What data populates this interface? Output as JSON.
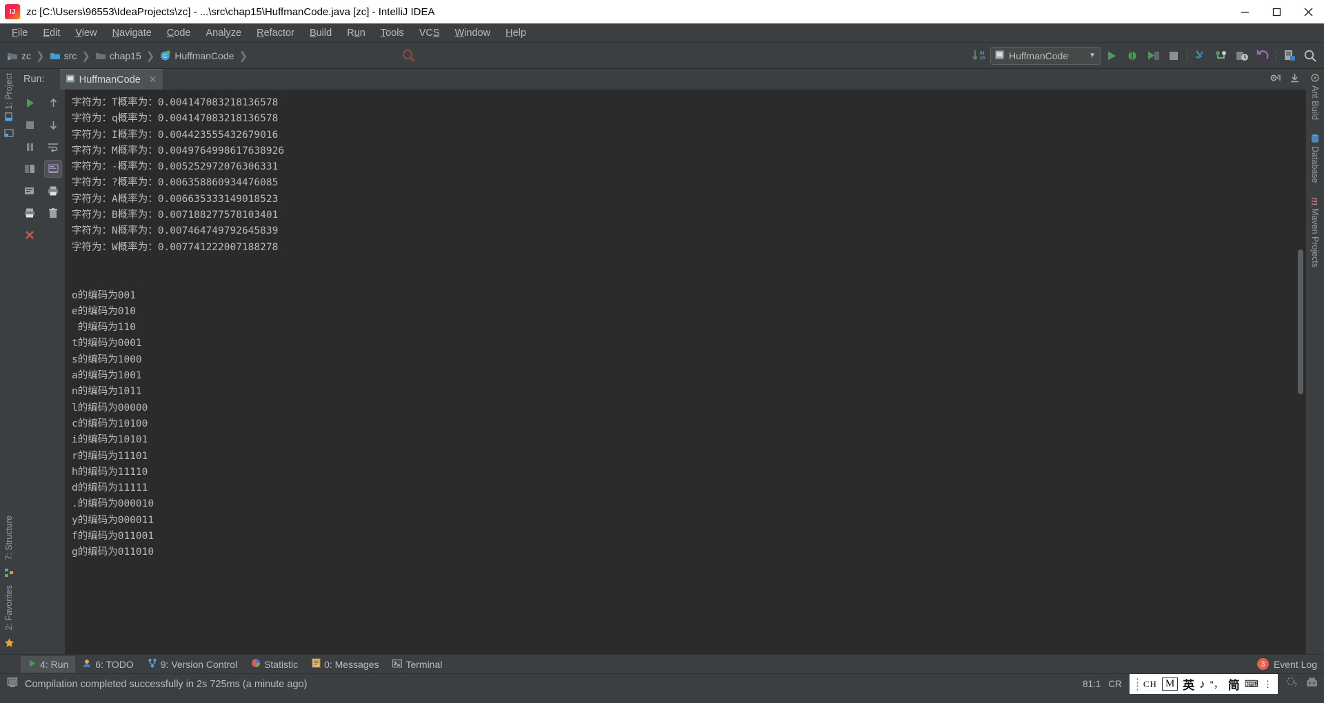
{
  "window": {
    "title": "zc [C:\\Users\\96553\\IdeaProjects\\zc] - ...\\src\\chap15\\HuffmanCode.java [zc] - IntelliJ IDEA",
    "logo_icon": "intellij-idea-logo",
    "minimize_icon": "minimize-icon",
    "maximize_icon": "maximize-icon",
    "close_icon": "close-icon"
  },
  "menubar": {
    "items": [
      {
        "label": "File",
        "mnemonic": "F"
      },
      {
        "label": "Edit",
        "mnemonic": "E"
      },
      {
        "label": "View",
        "mnemonic": "V"
      },
      {
        "label": "Navigate",
        "mnemonic": "N"
      },
      {
        "label": "Code",
        "mnemonic": "C"
      },
      {
        "label": "Analyze",
        "mnemonic": "y"
      },
      {
        "label": "Refactor",
        "mnemonic": "R"
      },
      {
        "label": "Build",
        "mnemonic": "B"
      },
      {
        "label": "Run",
        "mnemonic": "u"
      },
      {
        "label": "Tools",
        "mnemonic": "T"
      },
      {
        "label": "VCS",
        "mnemonic": "S"
      },
      {
        "label": "Window",
        "mnemonic": "W"
      },
      {
        "label": "Help",
        "mnemonic": "H"
      }
    ]
  },
  "navbar": {
    "breadcrumbs": [
      {
        "label": "zc",
        "icon": "project-module-icon"
      },
      {
        "label": "src",
        "icon": "source-folder-icon"
      },
      {
        "label": "chap15",
        "icon": "package-folder-icon"
      },
      {
        "label": "HuffmanCode",
        "icon": "java-class-icon"
      }
    ],
    "run_config": {
      "label": "HuffmanCode",
      "icon": "run-config-icon",
      "chevron": "chevron-down-icon"
    },
    "icons": [
      "update-project-icon",
      "run-icon",
      "debug-icon",
      "run-with-coverage-icon",
      "stop-icon",
      "vcs-update-icon",
      "vcs-commit-icon",
      "vcs-history-icon",
      "vcs-rollback-icon",
      "search-everywhere-icon",
      "settings-search-icon"
    ],
    "search_ghost_icon": "search-icon"
  },
  "left_stripe": {
    "top_items": [
      {
        "label": "1: Project",
        "icon": "project-tool-icon"
      },
      {
        "label": "",
        "icon": "structure-pin-icon"
      }
    ],
    "bottom_items": [
      {
        "label": "7: Structure",
        "icon": "structure-tool-icon"
      },
      {
        "label": "2: Favorites",
        "icon": "favorites-tool-icon"
      }
    ]
  },
  "right_stripe": {
    "items": [
      {
        "label": "Ant Build",
        "icon": "ant-build-icon"
      },
      {
        "label": "Database",
        "icon": "database-icon"
      },
      {
        "label": "Maven Projects",
        "icon": "maven-icon"
      }
    ]
  },
  "run_window": {
    "label": "Run:",
    "tab": {
      "label": "HuffmanCode",
      "icon": "run-config-icon",
      "close": "close-icon"
    },
    "header_icons": [
      "settings-gear-icon",
      "hide-window-icon"
    ],
    "left_controls": [
      {
        "name": "rerun-button",
        "icon": "run-icon"
      },
      {
        "name": "stop-button",
        "icon": "stop-icon"
      },
      {
        "name": "pause-button",
        "icon": "pause-icon"
      },
      {
        "name": "restore-layout-button",
        "icon": "restore-layout-icon"
      },
      {
        "name": "dump-threads-button",
        "icon": "dump-threads-icon"
      },
      {
        "name": "print-button",
        "icon": "print-icon"
      },
      {
        "name": "close-button",
        "icon": "close-x-icon"
      }
    ],
    "right_controls": [
      {
        "name": "scroll-up-button",
        "icon": "arrow-up-icon"
      },
      {
        "name": "scroll-down-button",
        "icon": "arrow-down-icon"
      },
      {
        "name": "soft-wrap-button",
        "icon": "soft-wrap-icon"
      },
      {
        "name": "scroll-to-end-button",
        "icon": "scroll-to-end-icon"
      },
      {
        "name": "print-output-button",
        "icon": "printer-icon"
      },
      {
        "name": "clear-all-button",
        "icon": "trash-icon"
      }
    ]
  },
  "console": {
    "lines": [
      "字符为：T概率为：0.004147083218136578",
      "字符为：q概率为：0.004147083218136578",
      "字符为：I概率为：0.004423555432679016",
      "字符为：M概率为：0.0049764998617638926",
      "字符为：-概率为：0.005252972076306331",
      "字符为：?概率为：0.006358860934476085",
      "字符为：A概率为：0.006635333149018523",
      "字符为：B概率为：0.007188277578103401",
      "字符为：N概率为：0.007464749792645839",
      "字符为：W概率为：0.007741222007188278",
      "",
      "o的编码为001",
      "e的编码为010",
      " 的编码为110",
      "t的编码为0001",
      "s的编码为1000",
      "a的编码为1001",
      "n的编码为1011",
      "l的编码为00000",
      "c的编码为10100",
      "i的编码为10101",
      "r的编码为11101",
      "h的编码为11110",
      "d的编码为11111",
      ".的编码为000010",
      "y的编码为000011",
      "f的编码为011001",
      "g的编码为011010"
    ]
  },
  "bottom_tabs": [
    {
      "label": "4: Run",
      "mnemonic": "4",
      "icon": "run-icon",
      "active": true
    },
    {
      "label": "6: TODO",
      "mnemonic": "6",
      "icon": "todo-icon",
      "active": false
    },
    {
      "label": "9: Version Control",
      "mnemonic": "9",
      "icon": "vcs-icon",
      "active": false
    },
    {
      "label": "Statistic",
      "mnemonic": "",
      "icon": "statistic-icon",
      "active": false
    },
    {
      "label": "0: Messages",
      "mnemonic": "0",
      "icon": "messages-icon",
      "active": false
    },
    {
      "label": "Terminal",
      "mnemonic": "",
      "icon": "terminal-icon",
      "active": false
    }
  ],
  "event_log": {
    "label": "Event Log",
    "count": "3"
  },
  "statusbar": {
    "message": "Compilation completed successfully in 2s 725ms (a minute ago)",
    "message_icon": "build-icon",
    "caret": "81:1",
    "line_sep": "CR",
    "ime": {
      "lang": "CH",
      "mode": "M",
      "input": "英",
      "tone": "♪",
      "punct": "\"，",
      "script": "简",
      "tool": "⌨",
      "more": "⋮"
    },
    "right_icons": [
      "inspection-icon",
      "hector-icon"
    ]
  },
  "colors": {
    "chrome": "#3c3f41",
    "console_bg": "#2b2b2b",
    "text": "#bbbbbb",
    "accent_green": "#499c54",
    "badge_red": "#e8604b",
    "tab_active": "#4e5254"
  }
}
